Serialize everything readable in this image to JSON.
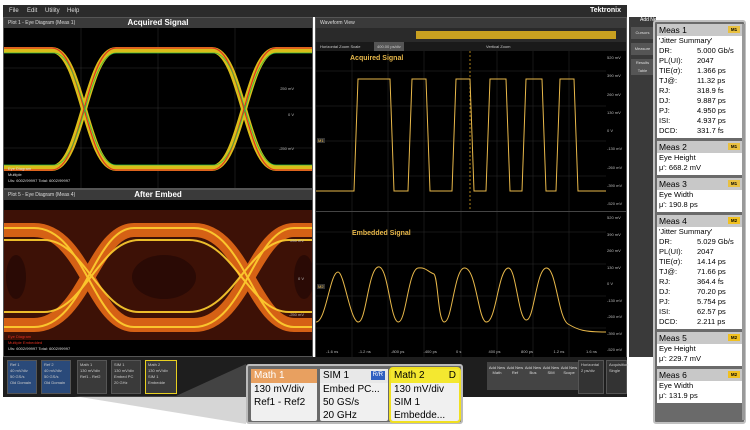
{
  "menu": {
    "items": [
      "File",
      "Edit",
      "Utility",
      "Help"
    ],
    "brand": "Tektronix"
  },
  "eye1": {
    "title": "Plot 1 - Eye Diagram (Meas 1)",
    "heading": "Acquired Signal",
    "yticks": [
      "250 mV",
      "0 V",
      "-250 mV"
    ],
    "stats": [
      "Eye Diagram",
      "Multiple",
      "UIs: 6002/99997 Total: 6002/99997"
    ]
  },
  "eye2": {
    "title": "Plot 5 - Eye Diagram (Meas 4)",
    "heading": "After Embed",
    "yticks": [
      "250 mV",
      "0 V",
      "-250 mV"
    ],
    "stats": [
      "Eye Diagram",
      "Multiple Embedded",
      "UIs: 6002/99997 Total: 6002/99997"
    ]
  },
  "wave": {
    "title": "Waveform View",
    "zoom_label": "Horizontal Zoom Scale",
    "zoom_value": "400.00 ps/div",
    "vzoom_label": "Vertical Zoom",
    "top_label": "Acquired Signal",
    "bottom_label": "Embedded Signal",
    "yticks_top": [
      "520 mV",
      "390 mV",
      "260 mV",
      "130 mV",
      "0 V",
      "-130 mV",
      "-260 mV",
      "-390 mV",
      "-520 mV"
    ],
    "yticks_bot": [
      "520 mV",
      "390 mV",
      "260 mV",
      "130 mV",
      "0 V",
      "-130 mV",
      "-260 mV",
      "-390 mV",
      "-520 mV"
    ],
    "xticks": [
      "-1.6 ns",
      "-1.2 ns",
      "-800 ps",
      "-400 ps",
      "0 s",
      "400 ps",
      "800 ps",
      "1.2 ns",
      "1.6 ns"
    ],
    "m1": "M1",
    "m2": "M2"
  },
  "rightstrip": {
    "cursors": "Cursors",
    "measure": "Measure",
    "results": "Results Table",
    "add": "Add New Measure"
  },
  "bottom": {
    "chips": [
      {
        "name": "Ref 1",
        "l1": "40 mV/div",
        "l2": "50 GS/s",
        "l3": "Old Domain"
      },
      {
        "name": "Ref 2",
        "l1": "40 mV/div",
        "l2": "50 GS/s",
        "l3": "Old Domain"
      },
      {
        "name": "Math 1",
        "l1": "130 mV/div",
        "l2": "Ref1 - Ref2",
        "l3": ""
      },
      {
        "name": "SIM 1",
        "l1": "130 mV/div",
        "l2": "Embed PC",
        "l3": "20 GHz"
      },
      {
        "name": "Math 2",
        "l1": "130 mV/div",
        "l2": "SIM 1",
        "l3": "Embedde"
      }
    ],
    "add_buttons": [
      "Add New Math",
      "Add New Ref",
      "Add New Bus",
      "Add New SIM",
      "Add New Scope"
    ],
    "horizontal": {
      "t": "Horizontal",
      "v": "2 ps/div"
    },
    "acquisition": {
      "t": "Acquisition",
      "v": "Single"
    }
  },
  "callout": {
    "math1": {
      "title": "Math 1",
      "l1": "130 mV/div",
      "l2": "Ref1 - Ref2"
    },
    "sim1": {
      "title": "SIM 1",
      "tag": "R/R",
      "l1": "Embed PC...",
      "l2": "50 GS/s",
      "l3": "20 GHz"
    },
    "math2": {
      "title": "Math 2",
      "tag": "D",
      "l1": "130 mV/div",
      "l2": "SIM 1",
      "l3": "Embedde..."
    }
  },
  "measurements": [
    {
      "title": "Meas 1",
      "badge": "M1",
      "rows": [
        [
          "'Jitter Summary'",
          ""
        ],
        [
          "DR:",
          "5.000 Gb/s"
        ],
        [
          "PL(UI):",
          "2047"
        ],
        [
          "TIE(σ):",
          "1.366 ps"
        ],
        [
          "TJ@:",
          "11.32 ps"
        ],
        [
          "RJ:",
          "318.9 fs"
        ],
        [
          "DJ:",
          "9.887 ps"
        ],
        [
          "PJ:",
          "4.950 ps"
        ],
        [
          "ISI:",
          "4.937 ps"
        ],
        [
          "DCD:",
          "331.7 fs"
        ]
      ]
    },
    {
      "title": "Meas 2",
      "badge": "M1",
      "rows": [
        [
          "Eye Height",
          ""
        ],
        [
          "μ': 668.2 mV",
          ""
        ]
      ]
    },
    {
      "title": "Meas 3",
      "badge": "M1",
      "rows": [
        [
          "Eye Width",
          ""
        ],
        [
          "μ': 190.8 ps",
          ""
        ]
      ]
    },
    {
      "title": "Meas 4",
      "badge": "M2",
      "rows": [
        [
          "'Jitter Summary'",
          ""
        ],
        [
          "DR:",
          "5.029 Gb/s"
        ],
        [
          "PL(UI):",
          "2047"
        ],
        [
          "TIE(σ):",
          "14.14 ps"
        ],
        [
          "TJ@:",
          "71.66 ps"
        ],
        [
          "RJ:",
          "364.4 fs"
        ],
        [
          "DJ:",
          "70.20 ps"
        ],
        [
          "PJ:",
          "5.754 ps"
        ],
        [
          "ISI:",
          "62.57 ps"
        ],
        [
          "DCD:",
          "2.211 ps"
        ]
      ]
    },
    {
      "title": "Meas 5",
      "badge": "M2",
      "rows": [
        [
          "Eye Height",
          ""
        ],
        [
          "μ': 229.7 mV",
          ""
        ]
      ]
    },
    {
      "title": "Meas 6",
      "badge": "M2",
      "rows": [
        [
          "Eye Width",
          ""
        ],
        [
          "μ': 131.9 ps",
          ""
        ]
      ]
    }
  ],
  "colors": {
    "accent": "#e8b84a",
    "m1": "#e8b84a",
    "m2": "#f0c040"
  }
}
